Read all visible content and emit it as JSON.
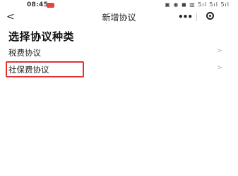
{
  "status_bar": {
    "time": "08:45",
    "icons": "▣ ◉ ◼ ▥ 5ıl 5ıl 5ıl"
  },
  "nav": {
    "title": "新增协议",
    "back_icon": "chevron-left-icon",
    "more_icon": "more-dots-icon",
    "close_icon": "capsule-close-icon"
  },
  "page": {
    "heading": "选择协议种类"
  },
  "options": [
    {
      "label": "税费协议"
    },
    {
      "label": "社保费协议"
    }
  ],
  "colors": {
    "highlight": "#e52f2f",
    "chevron": "#b5b5b5",
    "status_badge": "#e8463c"
  }
}
